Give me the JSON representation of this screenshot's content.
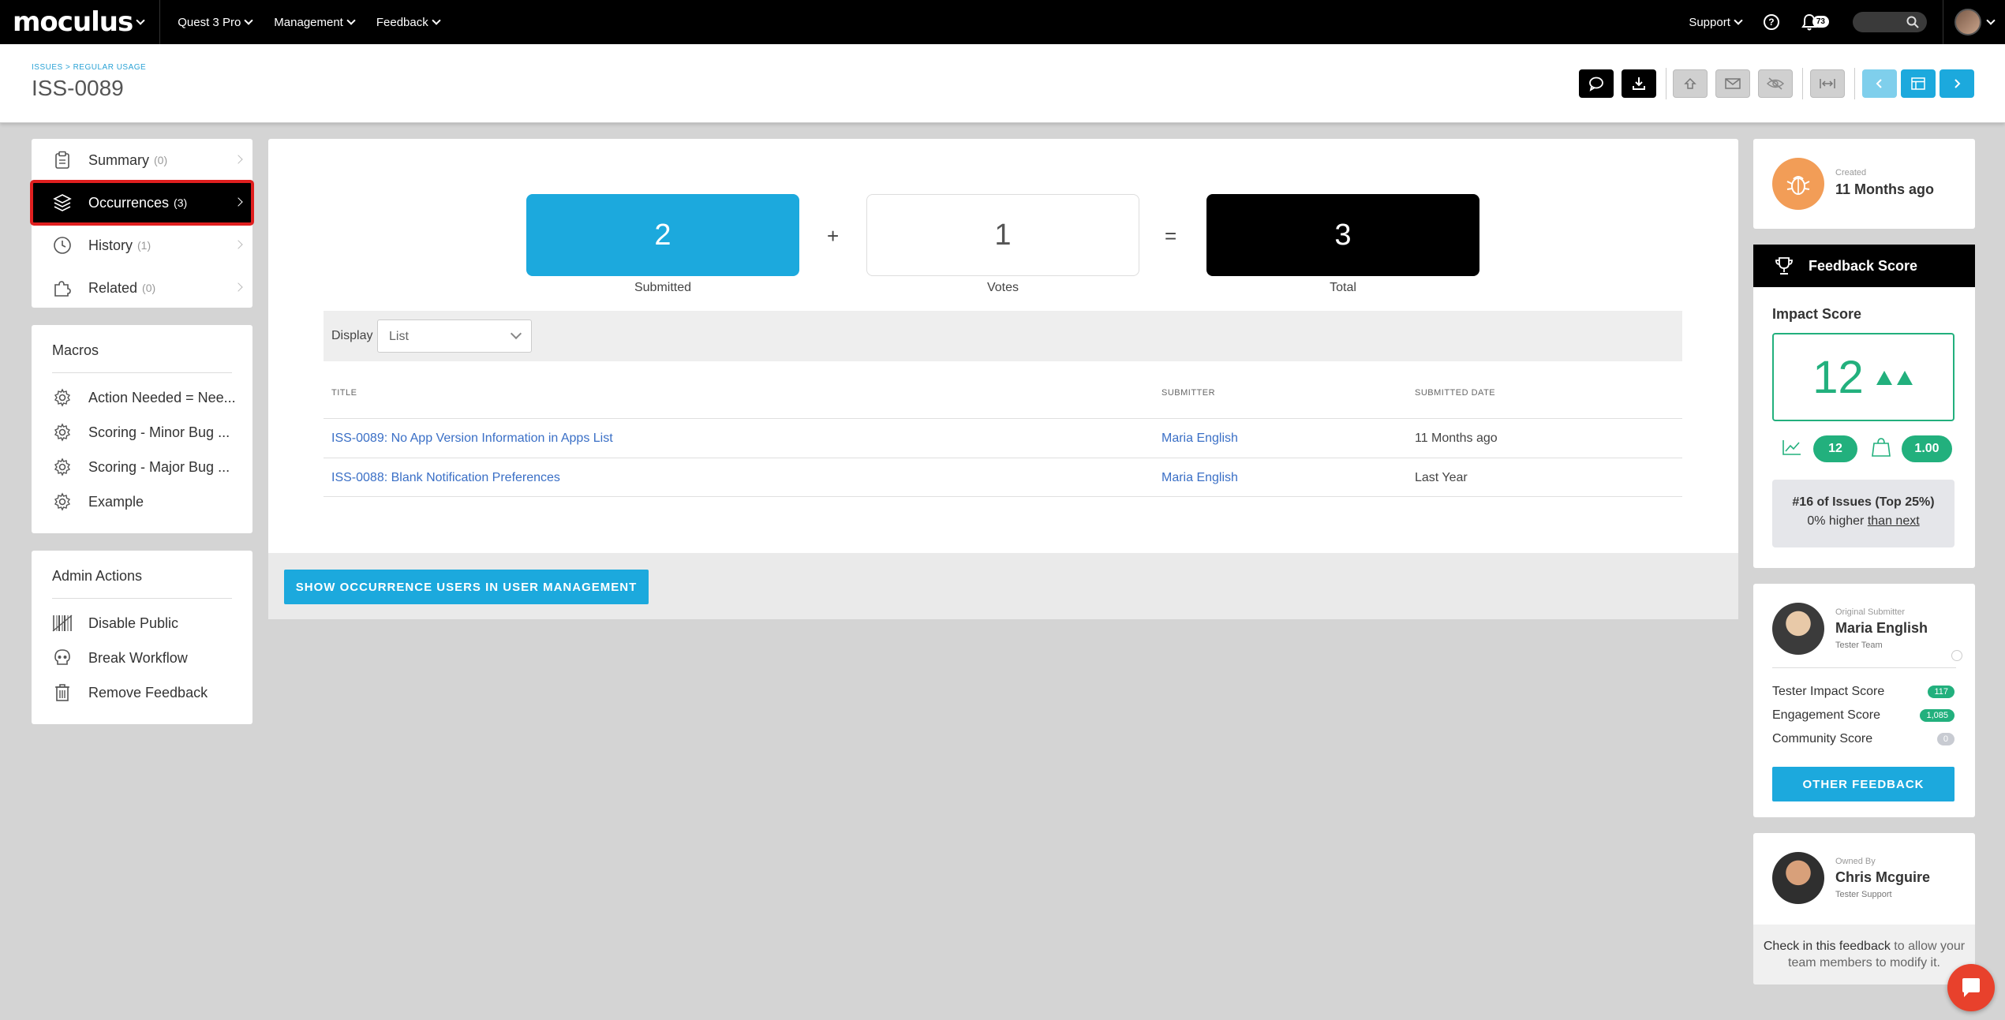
{
  "nav": {
    "logo": "moculus",
    "items": [
      {
        "label": "Quest 3 Pro"
      },
      {
        "label": "Management"
      },
      {
        "label": "Feedback"
      }
    ],
    "support_label": "Support",
    "notification_count": "73"
  },
  "header": {
    "breadcrumb": "ISSUES > REGULAR USAGE",
    "title": "ISS-0089"
  },
  "sidebar": {
    "items": [
      {
        "label": "Summary",
        "count": "(0)"
      },
      {
        "label": "Occurrences",
        "count": "(3)"
      },
      {
        "label": "History",
        "count": "(1)"
      },
      {
        "label": "Related",
        "count": "(0)"
      }
    ]
  },
  "macros": {
    "title": "Macros",
    "items": [
      {
        "label": "Action Needed = Nee..."
      },
      {
        "label": "Scoring - Minor Bug ..."
      },
      {
        "label": "Scoring - Major Bug ..."
      },
      {
        "label": "Example"
      }
    ]
  },
  "admin": {
    "title": "Admin Actions",
    "items": [
      {
        "label": "Disable Public"
      },
      {
        "label": "Break Workflow"
      },
      {
        "label": "Remove Feedback"
      }
    ]
  },
  "occurrences": {
    "submitted_value": "2",
    "submitted_label": "Submitted",
    "plus": "+",
    "votes_value": "1",
    "votes_label": "Votes",
    "equals": "=",
    "total_value": "3",
    "total_label": "Total",
    "display_label": "Display",
    "display_value": "List",
    "columns": [
      "TITLE",
      "SUBMITTER",
      "SUBMITTED DATE"
    ],
    "rows": [
      {
        "title": "ISS-0089: No App Version Information in Apps List",
        "submitter": "Maria English",
        "date": "11 Months ago"
      },
      {
        "title": "ISS-0088: Blank Notification Preferences",
        "submitter": "Maria English",
        "date": "Last Year"
      }
    ],
    "show_users_label": "SHOW OCCURRENCE USERS IN USER MANAGEMENT"
  },
  "created": {
    "label": "Created",
    "value": "11 Months ago"
  },
  "feedback_score": {
    "title": "Feedback Score",
    "impact_label": "Impact Score",
    "impact_value": "12",
    "trend_value": "12",
    "bag_value": "1.00",
    "rank": "#16 of Issues (Top 25%)",
    "higher_prefix": "0% higher ",
    "higher_link": "than next"
  },
  "submitter": {
    "label": "Original Submitter",
    "name": "Maria English",
    "team": "Tester Team",
    "scores": [
      {
        "label": "Tester Impact Score",
        "value": "117"
      },
      {
        "label": "Engagement Score",
        "value": "1,085"
      },
      {
        "label": "Community Score",
        "value": "0"
      }
    ],
    "other_label": "OTHER FEEDBACK"
  },
  "owner": {
    "label": "Owned By",
    "name": "Chris Mcguire",
    "team": "Tester Support",
    "checkin_link": "Check in this feedback",
    "checkin_rest": " to allow your team members to modify it."
  },
  "colors": {
    "accent": "#1ca9dd",
    "green": "#22b07d",
    "highlight": "#e01f1f"
  }
}
